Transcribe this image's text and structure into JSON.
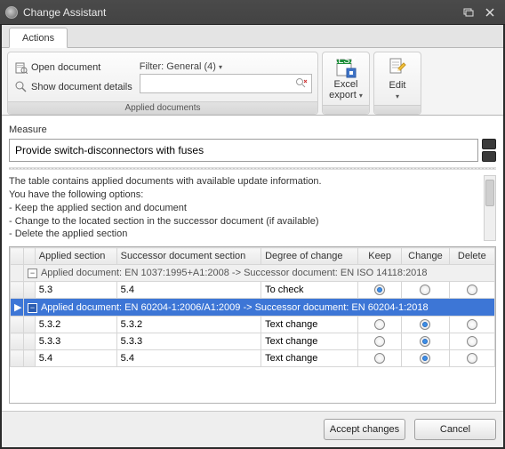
{
  "window": {
    "title": "Change Assistant"
  },
  "tabs": {
    "actions": "Actions"
  },
  "ribbon": {
    "openDocument": "Open document",
    "showDetails": "Show document details",
    "filterLabel": "Filter: General (4)",
    "searchPlaceholder": "",
    "groupDocsFooter": "Applied documents",
    "excel": {
      "label": "Excel export",
      "iconTag": "XLSX"
    },
    "edit": {
      "label": "Edit"
    }
  },
  "measure": {
    "label": "Measure",
    "value": "Provide switch-disconnectors with fuses"
  },
  "info": {
    "line1": "The table contains applied documents with available update information.",
    "line2": "You have the following options:",
    "line3": "- Keep the applied section and document",
    "line4": "- Change to the located section in the successor document (if available)",
    "line5": "- Delete the applied section"
  },
  "grid": {
    "headers": {
      "applied": "Applied section",
      "successor": "Successor document section",
      "degree": "Degree of change",
      "keep": "Keep",
      "change": "Change",
      "delete": "Delete"
    },
    "groups": [
      {
        "title": "Applied document: EN 1037:1995+A1:2008 -> Successor document: EN ISO 14118:2018",
        "selected": false,
        "rows": [
          {
            "applied": "5.3",
            "successor": "5.4",
            "degree": "To check",
            "choice": "keep"
          }
        ]
      },
      {
        "title": "Applied document: EN 60204-1:2006/A1:2009 -> Successor document: EN 60204-1:2018",
        "selected": true,
        "rows": [
          {
            "applied": "5.3.2",
            "successor": "5.3.2",
            "degree": "Text change",
            "choice": "change"
          },
          {
            "applied": "5.3.3",
            "successor": "5.3.3",
            "degree": "Text change",
            "choice": "change"
          },
          {
            "applied": "5.4",
            "successor": "5.4",
            "degree": "Text change",
            "choice": "change"
          }
        ]
      }
    ]
  },
  "footer": {
    "accept": "Accept changes",
    "cancel": "Cancel"
  }
}
